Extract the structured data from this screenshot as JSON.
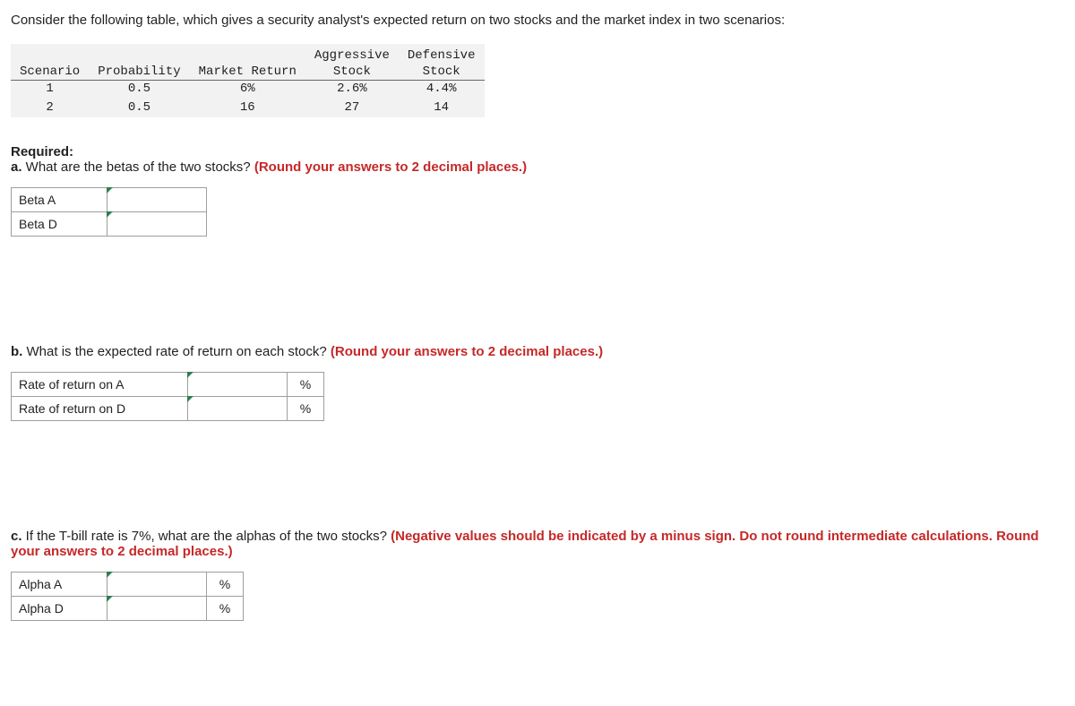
{
  "intro": "Consider the following table, which gives a security analyst's expected return on two stocks and the market index in two scenarios:",
  "table": {
    "headers": {
      "scenario": "Scenario",
      "probability": "Probability",
      "market_return": "Market Return",
      "aggressive_line1": "Aggressive",
      "aggressive_line2": "Stock",
      "defensive_line1": "Defensive",
      "defensive_line2": "Stock"
    },
    "rows": [
      {
        "scenario": "1",
        "probability": "0.5",
        "market_return": "6%",
        "aggressive": "2.6%",
        "defensive": "4.4%"
      },
      {
        "scenario": "2",
        "probability": "0.5",
        "market_return": "16",
        "aggressive": "27",
        "defensive": "14"
      }
    ]
  },
  "required_label": "Required:",
  "qa": {
    "label": "a.",
    "text": " What are the betas of the two stocks? ",
    "hint": "(Round your answers to 2 decimal places.)",
    "rows": [
      {
        "label": "Beta A"
      },
      {
        "label": "Beta D"
      }
    ]
  },
  "qb": {
    "label": "b.",
    "text": " What is the expected rate of return on each stock? ",
    "hint": "(Round your answers to 2 decimal places.)",
    "rows": [
      {
        "label": "Rate of return on A",
        "unit": "%"
      },
      {
        "label": "Rate of return on D",
        "unit": "%"
      }
    ]
  },
  "qc": {
    "label": "c.",
    "text": " If the T-bill rate is 7%, what are the alphas of the two stocks? ",
    "hint": "(Negative values should be indicated by a minus sign. Do not round intermediate calculations. Round your answers to 2 decimal places.)",
    "rows": [
      {
        "label": "Alpha A",
        "unit": "%"
      },
      {
        "label": "Alpha D",
        "unit": "%"
      }
    ]
  }
}
